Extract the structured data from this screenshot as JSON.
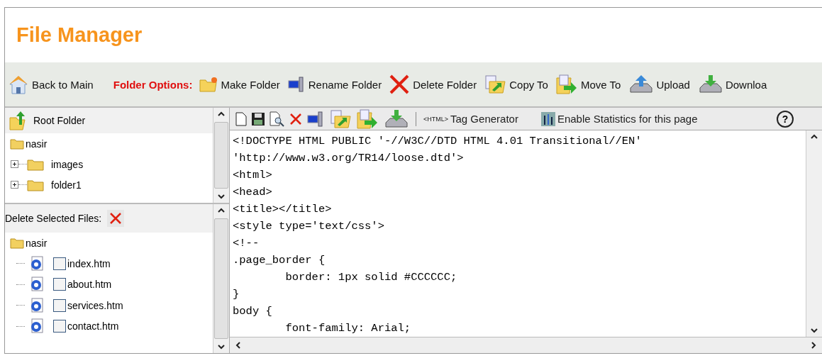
{
  "title": "File Manager",
  "toolbar": {
    "back": "Back to Main",
    "options_label": "Folder Options:",
    "actions": [
      "Make Folder",
      "Rename Folder",
      "Delete Folder",
      "Copy To",
      "Move To",
      "Upload",
      "Downloa"
    ]
  },
  "folder_tree": {
    "root": "Root Folder",
    "items": [
      {
        "label": "nasir",
        "children": [
          {
            "label": "images",
            "expanded": false
          },
          {
            "label": "folder1",
            "expanded": false
          }
        ]
      }
    ]
  },
  "files_panel": {
    "delete_label": "Delete Selected Files:",
    "folder": "nasir",
    "files": [
      {
        "name": "index.htm",
        "checked": false
      },
      {
        "name": "about.htm",
        "checked": false
      },
      {
        "name": "services.htm",
        "checked": false
      },
      {
        "name": "contact.htm",
        "checked": false
      }
    ]
  },
  "editor": {
    "tag_generator": "<HTML>",
    "tag_generator_label": "Tag Generator",
    "statistics": "Enable Statistics for this page",
    "help": "?",
    "lines": [
      "<!DOCTYPE HTML PUBLIC '-//W3C//DTD HTML 4.01 Transitional//EN'",
      "'http://www.w3.org/TR14/loose.dtd'>",
      "<html>",
      "<head>",
      "<title></title>",
      "<style type='text/css'>",
      "<!--",
      ".page_border {",
      "        border: 1px solid #CCCCCC;",
      "}",
      "body {",
      "        font-family: Arial;"
    ]
  }
}
